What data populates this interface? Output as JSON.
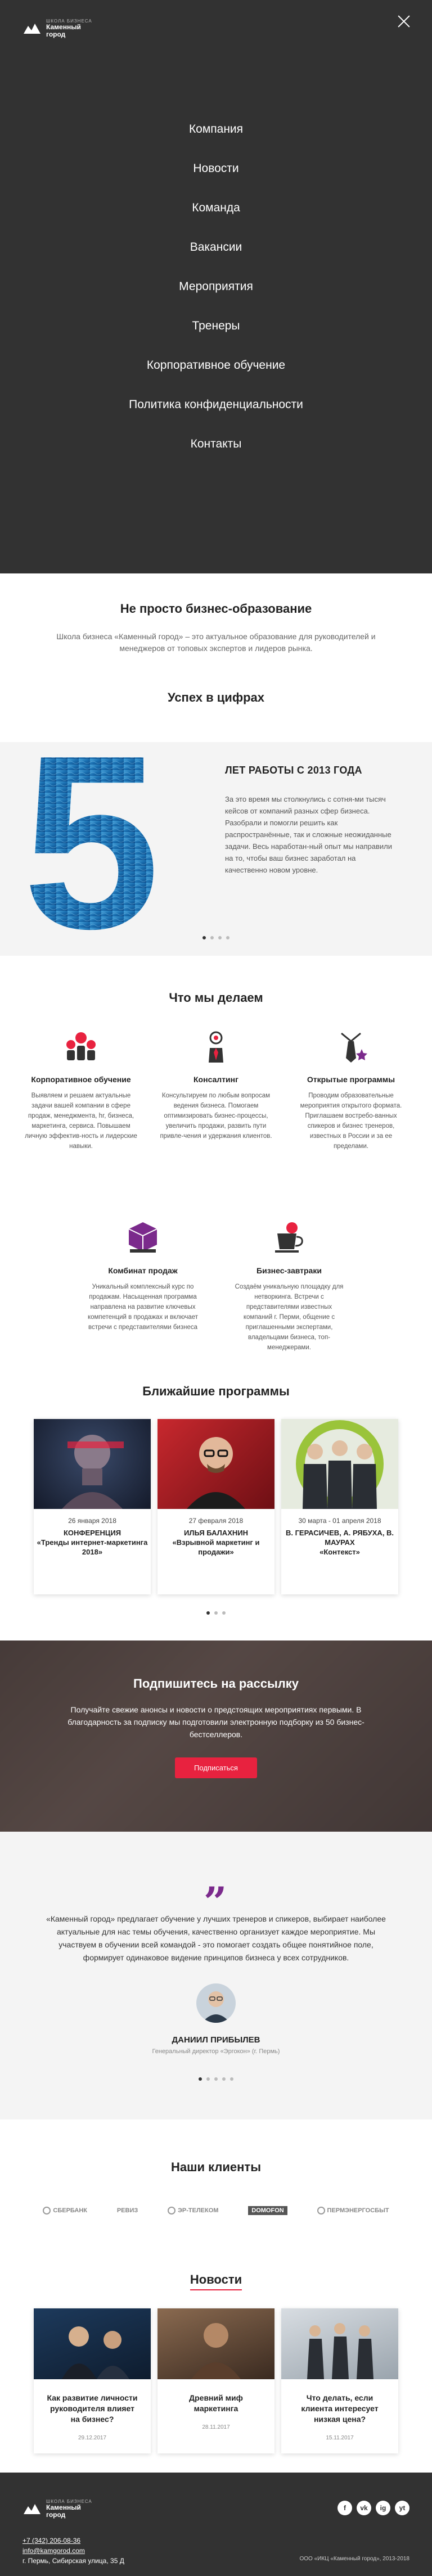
{
  "brand": {
    "small": "ШКОЛА БИЗНЕСА",
    "big_line1": "Каменный",
    "big_line2": "город"
  },
  "menu": {
    "items": [
      "Компания",
      "Новости",
      "Команда",
      "Вакансии",
      "Мероприятия",
      "Тренеры",
      "Корпоративное обучение",
      "Политика конфиденциальности",
      "Контакты"
    ]
  },
  "intro": {
    "title": "Не просто бизнес-образование",
    "text": "Школа бизнеса «Каменный город» – это актуальное образование для руководителей и менеджеров от топовых экспертов и лидеров рынка."
  },
  "success": {
    "title": "Успех в цифрах",
    "number": "5",
    "subtitle": "ЛЕТ РАБОТЫ С 2013 ГОДА",
    "text": "За это время мы столкнулись с сотня-ми тысяч кейсов от компаний разных сфер бизнеса. Разобрали и помогли решить как распространённые, так и сложные неожиданные задачи. Весь наработан-ный опыт мы направили на то, чтобы ваш бизнес заработал на качественно новом уровне."
  },
  "what": {
    "title": "Что мы делаем",
    "items": [
      {
        "icon": "people-icon",
        "title": "Корпоративное обучение",
        "text": "Выявляем и решаем актуальные задачи вашей компании в сфере продаж, менеджмента, hr, бизнеса, маркетинга, сервиса. Повышаем личную эффектив-ность и лидерские навыки."
      },
      {
        "icon": "person-gear-icon",
        "title": "Консалтинг",
        "text": "Консультируем по любым вопросам ведения бизнеса. Помогаем оптимизировать бизнес-процессы, увеличить продажи, развить пути привле-чения и удержания клиентов."
      },
      {
        "icon": "tie-star-icon",
        "title": "Открытые программы",
        "text": "Проводим образовательные мероприятия открытого формата. Приглашаем востребо-ванных спикеров и бизнес тренеров, известных в России и за ее пределами."
      },
      {
        "icon": "cube-icon",
        "title": "Комбинат продаж",
        "text": "Уникальный комплексный курс по продажам. Насыщенная программа направлена на развитие ключевых компетенций в продажах и включает встречи с представителями бизнеса"
      },
      {
        "icon": "cup-icon",
        "title": "Бизнес-завтраки",
        "text": "Создаём уникальную площадку для нетворкинга. Встречи с представителями известных компаний г. Перми, общение с приглашенными экспертами, владельцами бизнеса, топ-менеджерами."
      }
    ]
  },
  "programs": {
    "title": "Ближайшие программы",
    "items": [
      {
        "date": "26 января 2018",
        "title": "КОНФЕРЕНЦИЯ",
        "sub": "«Тренды интернет-маркетинга 2018»"
      },
      {
        "date": "27 февраля 2018",
        "title": "ИЛЬЯ БАЛАХНИН",
        "sub": "«Взрывной маркетинг и продажи»"
      },
      {
        "date": "30 марта - 01 апреля 2018",
        "title": "В. ГЕРАСИЧЕВ, А. РЯБУХА, В. МАУРАХ",
        "sub": "«Контекст»"
      }
    ]
  },
  "subscribe": {
    "title": "Подпишитесь на рассылку",
    "text": "Получайте свежие анонсы и новости о предстоящих мероприятиях первыми. В благодарность за подписку мы подготовили электронную подборку из 50 бизнес-бестселлеров.",
    "button": "Подписаться"
  },
  "testimonial": {
    "quote_mark": "„",
    "text": "«Каменный город» предлагает обучение у лучших тренеров и спикеров, выбирает наиболее актуальные для нас темы обучения, качественно организует каждое мероприятие. Мы участвуем в обучении всей командой - это помогает создать общее понятийное поле, формирует одинаковое видение принципов бизнеса у всех сотрудников.",
    "name": "ДАНИИЛ ПРИБЫЛЕВ",
    "role": "Генеральный директор «Эргокон» (г. Пермь)"
  },
  "clients": {
    "title": "Наши клиенты",
    "logos": [
      "СБЕРБАНК",
      "РЕВИЗ",
      "ЭР-ТЕЛЕКОМ",
      "DOMOFON",
      "ПЕРМЭНЕРГОСБЫТ"
    ]
  },
  "news": {
    "title": "Новости",
    "items": [
      {
        "title": "Как развитие личности руководителя влияет на бизнес?",
        "date": "29.12.2017"
      },
      {
        "title": "Древний миф маркетинга",
        "date": "28.11.2017"
      },
      {
        "title": "Что делать, если клиента интересует низкая цена?",
        "date": "15.11.2017"
      }
    ]
  },
  "footer": {
    "phone": "+7 (342) 206-08-36",
    "email": "info@kamgorod.com",
    "address": "г. Пермь, Сибирская улица, 35 Д",
    "copyright": "ООО «ИКЦ «Каменный город», 2013-2018",
    "socials": [
      "f",
      "vk",
      "ig",
      "yt"
    ]
  },
  "colors": {
    "dark": "#323232",
    "accent": "#e8223f",
    "purple": "#7b2a8c",
    "sea": "#1a6fb0"
  }
}
